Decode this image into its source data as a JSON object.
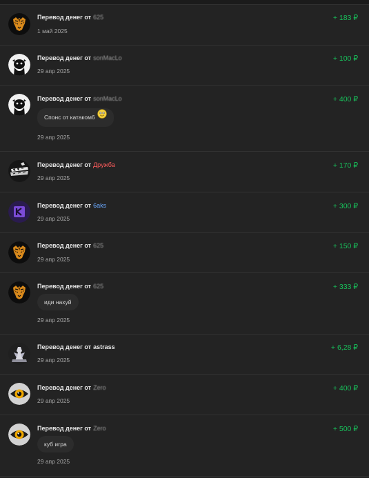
{
  "transfers": [
    {
      "title": "Перевод денег от",
      "sender": "625",
      "date": "1 май 2025",
      "amount": "+ 183 ₽",
      "message": "",
      "avatar": "tiger-avatar-icon"
    },
    {
      "title": "Перевод денег от",
      "sender": "sonMacLo",
      "date": "29 апр 2025",
      "amount": "+ 100 ₽",
      "message": "",
      "avatar": "dark-creature-avatar-icon"
    },
    {
      "title": "Перевод денег от",
      "sender": "sonMacLo",
      "date": "29 апр 2025",
      "amount": "+ 400 ₽",
      "message": "Спонс от катаком6",
      "avatar": "dark-creature-avatar-icon"
    },
    {
      "title": "Перевод денег от",
      "sender": "Дружба",
      "date": "29 апр 2025",
      "amount": "+ 170 ₽",
      "message": "",
      "avatar": "graffiti-avatar-icon"
    },
    {
      "title": "Перевод денег от",
      "sender": "6aks",
      "date": "29 апр 2025",
      "amount": "+ 300 ₽",
      "message": "",
      "avatar": "letter-k-avatar-icon"
    },
    {
      "title": "Перевод денег от",
      "sender": "625",
      "date": "29 апр 2025",
      "amount": "+ 150 ₽",
      "message": "",
      "avatar": "tiger-avatar-icon"
    },
    {
      "title": "Перевод денег от",
      "sender": "625",
      "date": "29 апр 2025",
      "amount": "+ 333 ₽",
      "message": "иди нахуй",
      "avatar": "tiger-avatar-icon"
    },
    {
      "title": "Перевод денег от",
      "sender": "astrass",
      "date": "29 апр 2025",
      "amount": "+ 6,28 ₽",
      "message": "",
      "avatar": "figure-avatar-icon"
    },
    {
      "title": "Перевод денег от",
      "sender": "Zero",
      "date": "29 апр 2025",
      "amount": "+ 400 ₽",
      "message": "",
      "avatar": "eye-avatar-icon"
    },
    {
      "title": "Перевод денег от",
      "sender": "Zero",
      "date": "29 апр 2025",
      "amount": "+ 500 ₽",
      "message": "куб игра",
      "avatar": "eye-avatar-icon"
    }
  ],
  "colors": {
    "background": "#232323",
    "divider": "#323232",
    "amount": "#18c25b",
    "sender_red": "#ff5c5c",
    "sender_blue": "#6aa9ff"
  }
}
